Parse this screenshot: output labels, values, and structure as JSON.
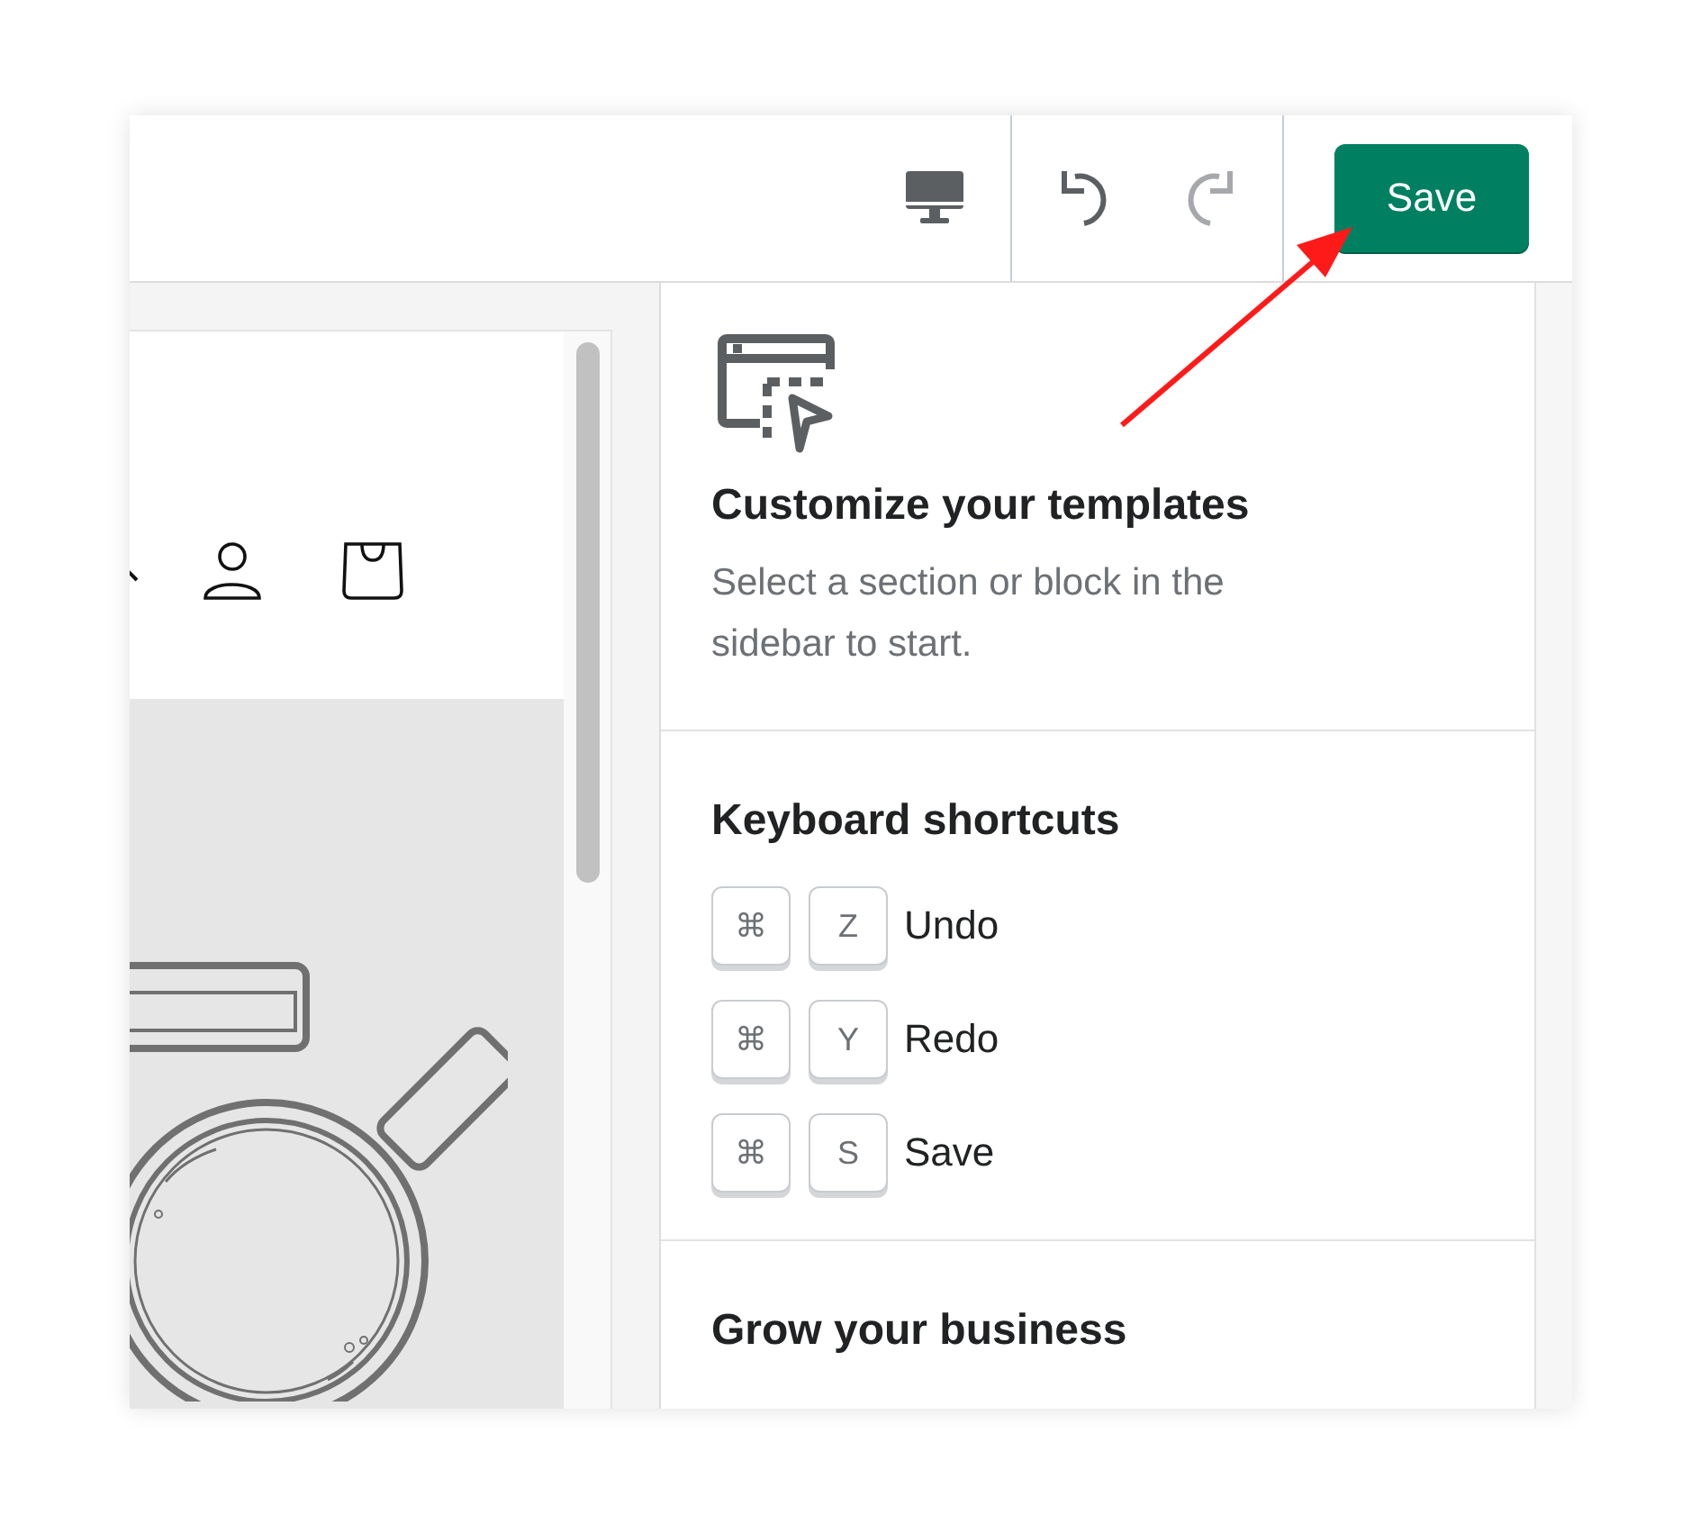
{
  "toolbar": {
    "history_buttons": [
      {
        "kind": "undo",
        "disabled": false
      },
      {
        "kind": "redo",
        "disabled": true
      }
    ],
    "save_button": {
      "label": "Save"
    }
  },
  "empty_state": {
    "title": "Customize your templates",
    "text": "Select a section or block in the sidebar to start."
  },
  "shortcuts": {
    "title": "Keyboard shortcuts",
    "items": [
      {
        "keys": [
          "⌘",
          "Z"
        ],
        "action": "Undo"
      },
      {
        "keys": [
          "⌘",
          "Y"
        ],
        "action": "Redo"
      },
      {
        "keys": [
          "⌘",
          "S"
        ],
        "action": "Save"
      }
    ]
  },
  "grow": {
    "title": "Grow your business"
  }
}
